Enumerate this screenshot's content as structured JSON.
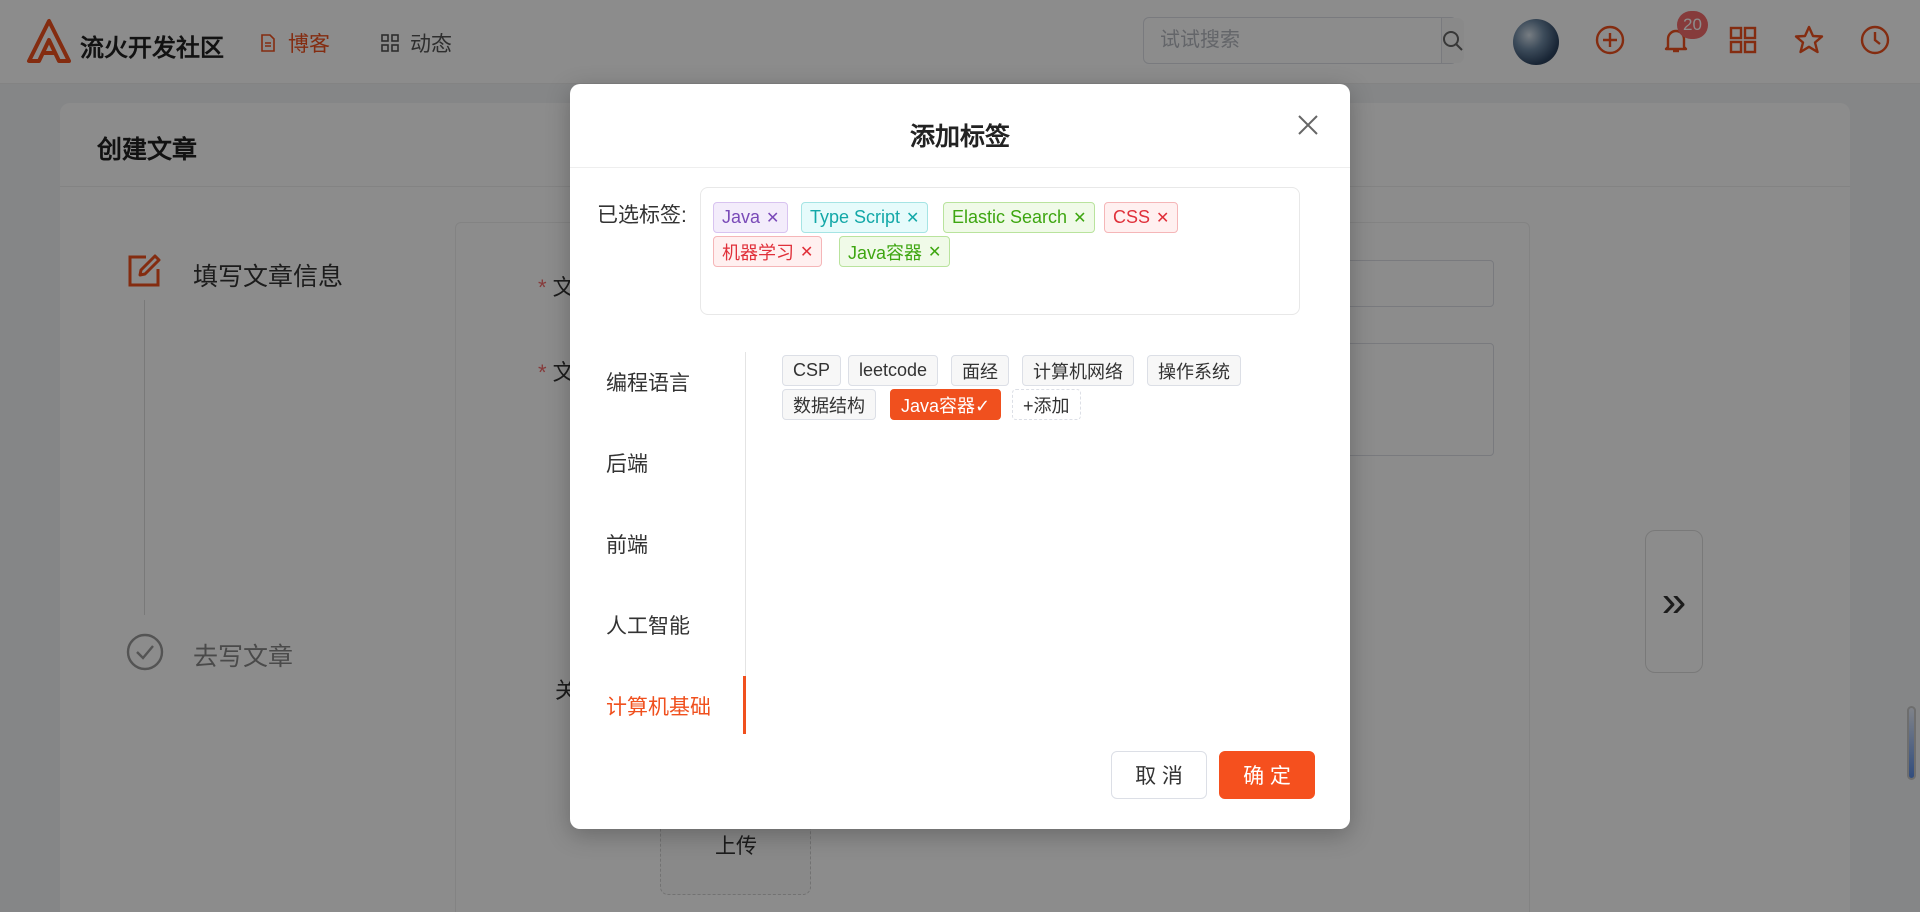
{
  "header": {
    "brand": "流火开发社区",
    "nav": [
      {
        "label": "博客",
        "icon": "document-icon",
        "active": true
      },
      {
        "label": "动态",
        "icon": "grid-icon",
        "active": false
      }
    ],
    "search": {
      "placeholder": "试试搜索",
      "value": ""
    },
    "notification_count": "20",
    "icons": [
      "plus-circle-icon",
      "bell-icon",
      "apps-grid-icon",
      "star-icon",
      "clock-icon"
    ]
  },
  "page": {
    "title": "创建文章",
    "steps": [
      {
        "label": "填写文章信息",
        "state": "active"
      },
      {
        "label": "去写文章",
        "state": "pending"
      }
    ],
    "form_labels": [
      "文",
      "文",
      "关"
    ],
    "upload_label": "上传",
    "next_label": "»"
  },
  "dialog": {
    "title": "添加标签",
    "selected_label": "已选标签:",
    "selected_tags": [
      {
        "label": "Java",
        "color": "#7a4ab8"
      },
      {
        "label": "Type Script",
        "color": "#13a8a8"
      },
      {
        "label": "Elastic Search",
        "color": "#3ea611"
      },
      {
        "label": "CSS",
        "color": "#e0303a"
      },
      {
        "label": "机器学习",
        "color": "#e0303a"
      },
      {
        "label": "Java容器",
        "color": "#3ea611"
      }
    ],
    "categories": [
      {
        "label": "编程语言",
        "active": false
      },
      {
        "label": "后端",
        "active": false
      },
      {
        "label": "前端",
        "active": false
      },
      {
        "label": "人工智能",
        "active": false
      },
      {
        "label": "计算机基础",
        "active": true
      }
    ],
    "category_tags": [
      {
        "label": "CSP",
        "selected": false
      },
      {
        "label": "leetcode",
        "selected": false
      },
      {
        "label": "面经",
        "selected": false
      },
      {
        "label": "计算机网络",
        "selected": false
      },
      {
        "label": "操作系统",
        "selected": false
      },
      {
        "label": "数据结构",
        "selected": false
      },
      {
        "label": "Java容器✓",
        "selected": true
      }
    ],
    "add_label": "+添加",
    "cancel_label": "取 消",
    "confirm_label": "确 定"
  },
  "colors": {
    "accent": "#f0501e",
    "badge": "#f56c6c"
  }
}
